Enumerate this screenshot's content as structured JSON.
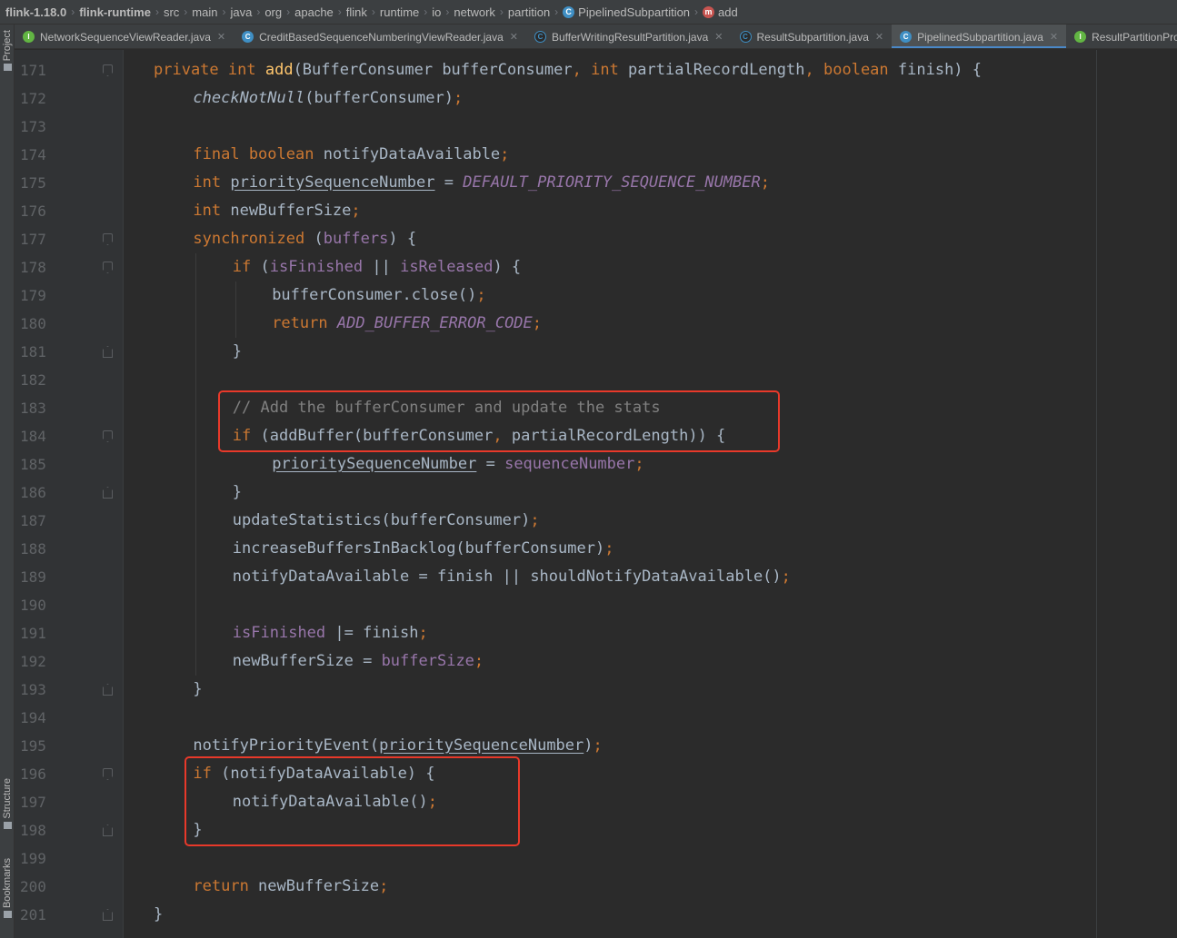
{
  "breadcrumbs": [
    {
      "label": "flink-1.18.0",
      "bold": true,
      "icon": ""
    },
    {
      "label": "flink-runtime",
      "bold": true,
      "icon": ""
    },
    {
      "label": "src",
      "bold": false,
      "icon": ""
    },
    {
      "label": "main",
      "bold": false,
      "icon": ""
    },
    {
      "label": "java",
      "bold": false,
      "icon": ""
    },
    {
      "label": "org",
      "bold": false,
      "icon": ""
    },
    {
      "label": "apache",
      "bold": false,
      "icon": ""
    },
    {
      "label": "flink",
      "bold": false,
      "icon": ""
    },
    {
      "label": "runtime",
      "bold": false,
      "icon": ""
    },
    {
      "label": "io",
      "bold": false,
      "icon": ""
    },
    {
      "label": "network",
      "bold": false,
      "icon": ""
    },
    {
      "label": "partition",
      "bold": false,
      "icon": ""
    },
    {
      "label": "PipelinedSubpartition",
      "bold": false,
      "icon": "class-icon",
      "glyph": "C"
    },
    {
      "label": "add",
      "bold": false,
      "icon": "method-icon",
      "glyph": "m"
    }
  ],
  "side_panels": {
    "project": "Project",
    "structure": "Structure",
    "bookmarks": "Bookmarks"
  },
  "tabs": [
    {
      "label": "NetworkSequenceViewReader.java",
      "icon": "interface-icon",
      "glyph": "I",
      "closable": true,
      "active": false
    },
    {
      "label": "CreditBasedSequenceNumberingViewReader.java",
      "icon": "class-icon",
      "glyph": "C",
      "closable": true,
      "active": false
    },
    {
      "label": "BufferWritingResultPartition.java",
      "icon": "abstract-class-icon",
      "glyph": "C",
      "closable": true,
      "active": false
    },
    {
      "label": "ResultSubpartition.java",
      "icon": "abstract-class-icon",
      "glyph": "C",
      "closable": true,
      "active": false
    },
    {
      "label": "PipelinedSubpartition.java",
      "icon": "class-icon",
      "glyph": "C",
      "closable": true,
      "active": true
    },
    {
      "label": "ResultPartitionProvide",
      "icon": "interface-icon",
      "glyph": "I",
      "closable": false,
      "active": false
    }
  ],
  "code_lines": [
    {
      "n": "171",
      "indent": 0,
      "fold": "open",
      "tokens": [
        [
          "private ",
          "kw"
        ],
        [
          "int ",
          "kw"
        ],
        [
          "add",
          "fn-decl"
        ],
        [
          "(BufferConsumer bufferConsumer",
          "plain"
        ],
        [
          ", ",
          "kw"
        ],
        [
          "int ",
          "kw"
        ],
        [
          "partialRecordLength",
          "plain"
        ],
        [
          ", ",
          "kw"
        ],
        [
          "boolean ",
          "kw"
        ],
        [
          "finish) {",
          "plain"
        ]
      ]
    },
    {
      "n": "172",
      "indent": 1,
      "fold": "",
      "tokens": [
        [
          "checkNotNull",
          "it"
        ],
        [
          "(bufferConsumer)",
          "plain"
        ],
        [
          ";",
          "kw"
        ]
      ]
    },
    {
      "n": "173",
      "indent": 0,
      "fold": "",
      "tokens": []
    },
    {
      "n": "174",
      "indent": 1,
      "fold": "",
      "tokens": [
        [
          "final ",
          "kw"
        ],
        [
          "boolean ",
          "kw"
        ],
        [
          "notifyDataAvailable",
          "plain"
        ],
        [
          ";",
          "kw"
        ]
      ]
    },
    {
      "n": "175",
      "indent": 1,
      "fold": "",
      "tokens": [
        [
          "int ",
          "kw"
        ],
        [
          "prioritySequenceNumber",
          "ul"
        ],
        [
          " = ",
          "plain"
        ],
        [
          "DEFAULT_PRIORITY_SEQUENCE_NUMBER",
          "const"
        ],
        [
          ";",
          "kw"
        ]
      ]
    },
    {
      "n": "176",
      "indent": 1,
      "fold": "",
      "tokens": [
        [
          "int ",
          "kw"
        ],
        [
          "newBufferSize",
          "plain"
        ],
        [
          ";",
          "kw"
        ]
      ]
    },
    {
      "n": "177",
      "indent": 1,
      "fold": "open",
      "tokens": [
        [
          "synchronized ",
          "kw"
        ],
        [
          "(",
          "plain"
        ],
        [
          "buffers",
          "field"
        ],
        [
          ") {",
          "plain"
        ]
      ]
    },
    {
      "n": "178",
      "indent": 2,
      "fold": "open",
      "tokens": [
        [
          "if ",
          "kw"
        ],
        [
          "(",
          "plain"
        ],
        [
          "isFinished",
          "field"
        ],
        [
          " || ",
          "plain"
        ],
        [
          "isReleased",
          "field"
        ],
        [
          ") {",
          "plain"
        ]
      ]
    },
    {
      "n": "179",
      "indent": 3,
      "fold": "",
      "tokens": [
        [
          "bufferConsumer.close()",
          "plain"
        ],
        [
          ";",
          "kw"
        ]
      ]
    },
    {
      "n": "180",
      "indent": 3,
      "fold": "",
      "tokens": [
        [
          "return ",
          "kw"
        ],
        [
          "ADD_BUFFER_ERROR_CODE",
          "const"
        ],
        [
          ";",
          "kw"
        ]
      ]
    },
    {
      "n": "181",
      "indent": 2,
      "fold": "close",
      "tokens": [
        [
          "}",
          "plain"
        ]
      ]
    },
    {
      "n": "182",
      "indent": 0,
      "fold": "",
      "tokens": []
    },
    {
      "n": "183",
      "indent": 2,
      "fold": "",
      "tokens": [
        [
          "// Add the bufferConsumer and update the stats",
          "cmt"
        ]
      ]
    },
    {
      "n": "184",
      "indent": 2,
      "fold": "open",
      "tokens": [
        [
          "if ",
          "kw"
        ],
        [
          "(addBuffer(bufferConsumer",
          "plain"
        ],
        [
          ", ",
          "kw"
        ],
        [
          "partialRecordLength)) {",
          "plain"
        ]
      ]
    },
    {
      "n": "185",
      "indent": 3,
      "fold": "",
      "tokens": [
        [
          "prioritySequenceNumber",
          "ul"
        ],
        [
          " = ",
          "plain"
        ],
        [
          "sequenceNumber",
          "field"
        ],
        [
          ";",
          "kw"
        ]
      ]
    },
    {
      "n": "186",
      "indent": 2,
      "fold": "close",
      "tokens": [
        [
          "}",
          "plain"
        ]
      ]
    },
    {
      "n": "187",
      "indent": 2,
      "fold": "",
      "tokens": [
        [
          "updateStatistics(bufferConsumer)",
          "plain"
        ],
        [
          ";",
          "kw"
        ]
      ]
    },
    {
      "n": "188",
      "indent": 2,
      "fold": "",
      "tokens": [
        [
          "increaseBuffersInBacklog(bufferConsumer)",
          "plain"
        ],
        [
          ";",
          "kw"
        ]
      ]
    },
    {
      "n": "189",
      "indent": 2,
      "fold": "",
      "tokens": [
        [
          "notifyDataAvailable = finish || shouldNotifyDataAvailable()",
          "plain"
        ],
        [
          ";",
          "kw"
        ]
      ]
    },
    {
      "n": "190",
      "indent": 0,
      "fold": "",
      "tokens": []
    },
    {
      "n": "191",
      "indent": 2,
      "fold": "",
      "tokens": [
        [
          "isFinished",
          "field"
        ],
        [
          " |= finish",
          "plain"
        ],
        [
          ";",
          "kw"
        ]
      ]
    },
    {
      "n": "192",
      "indent": 2,
      "fold": "",
      "tokens": [
        [
          "newBufferSize = ",
          "plain"
        ],
        [
          "bufferSize",
          "field"
        ],
        [
          ";",
          "kw"
        ]
      ]
    },
    {
      "n": "193",
      "indent": 1,
      "fold": "close",
      "tokens": [
        [
          "}",
          "plain"
        ]
      ]
    },
    {
      "n": "194",
      "indent": 0,
      "fold": "",
      "tokens": []
    },
    {
      "n": "195",
      "indent": 1,
      "fold": "",
      "tokens": [
        [
          "notifyPriorityEvent(",
          "plain"
        ],
        [
          "prioritySequenceNumber",
          "ul"
        ],
        [
          ")",
          "plain"
        ],
        [
          ";",
          "kw"
        ]
      ]
    },
    {
      "n": "196",
      "indent": 1,
      "fold": "open",
      "tokens": [
        [
          "if ",
          "kw"
        ],
        [
          "(notifyDataAvailable) {",
          "plain"
        ]
      ]
    },
    {
      "n": "197",
      "indent": 2,
      "fold": "",
      "tokens": [
        [
          "notifyDataAvailable()",
          "plain"
        ],
        [
          ";",
          "kw"
        ]
      ]
    },
    {
      "n": "198",
      "indent": 1,
      "fold": "close",
      "tokens": [
        [
          "}",
          "plain"
        ]
      ]
    },
    {
      "n": "199",
      "indent": 0,
      "fold": "",
      "tokens": []
    },
    {
      "n": "200",
      "indent": 1,
      "fold": "",
      "tokens": [
        [
          "return ",
          "kw"
        ],
        [
          "newBufferSize",
          "plain"
        ],
        [
          ";",
          "kw"
        ]
      ]
    },
    {
      "n": "201",
      "indent": 0,
      "fold": "close",
      "tokens": [
        [
          "}",
          "plain"
        ]
      ]
    }
  ],
  "highlights": [
    {
      "name": "highlight-add-buffer",
      "from_line": "183",
      "to_line": "184"
    },
    {
      "name": "highlight-notify-data-available",
      "from_line": "196",
      "to_line": "198"
    }
  ],
  "colors": {
    "highlight_border": "#e8392a",
    "keyword": "#cc7832",
    "method_decl": "#ffc66d",
    "field": "#9876aa",
    "comment": "#808080",
    "text": "#a9b7c6"
  }
}
